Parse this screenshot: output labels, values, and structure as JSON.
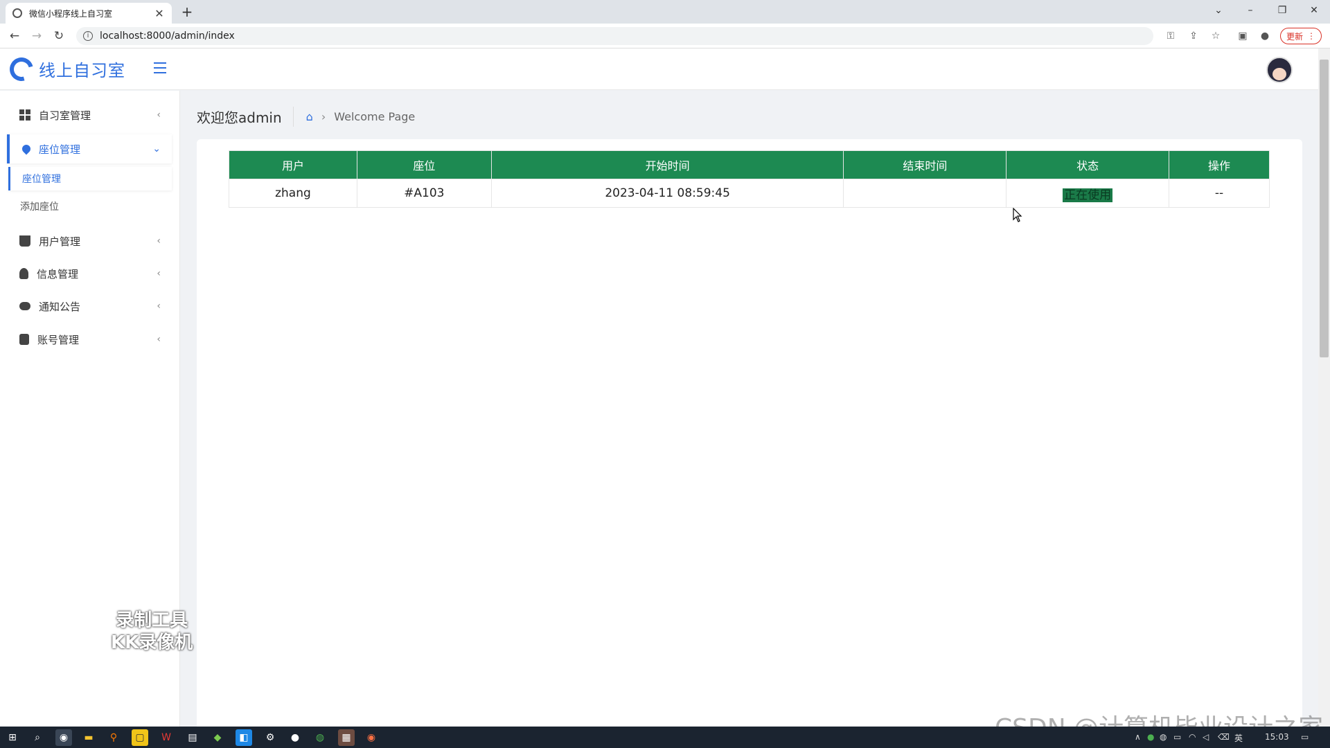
{
  "browser": {
    "tab_title": "微信小程序线上自习室",
    "url": "localhost:8000/admin/index",
    "update_label": "更新"
  },
  "app": {
    "brand": "线上自习室"
  },
  "sidebar": {
    "items": [
      {
        "label": "自习室管理",
        "icon": "grid-icon"
      },
      {
        "label": "座位管理",
        "icon": "drop-icon",
        "active": true
      },
      {
        "label": "用户管理",
        "icon": "basket-icon"
      },
      {
        "label": "信息管理",
        "icon": "bulb-icon"
      },
      {
        "label": "通知公告",
        "icon": "cloud-download-icon"
      },
      {
        "label": "账号管理",
        "icon": "database-icon"
      }
    ],
    "sub_items": [
      {
        "label": "座位管理",
        "active": true
      },
      {
        "label": "添加座位"
      }
    ]
  },
  "header": {
    "welcome": "欢迎您admin",
    "crumb": "Welcome Page"
  },
  "table": {
    "columns": [
      "用户",
      "座位",
      "开始时间",
      "结束时间",
      "状态",
      "操作"
    ],
    "rows": [
      {
        "user": "zhang",
        "seat": "#A103",
        "start": "2023-04-11 08:59:45",
        "end": "",
        "status": "正在使用",
        "action": "--"
      }
    ]
  },
  "overlay": {
    "recorder_line1": "录制工具",
    "recorder_line2": "KK录像机",
    "watermark": "CSDN @计算机毕业设计之家"
  },
  "taskbar": {
    "ime": "英",
    "time": "15:03"
  },
  "colors": {
    "accent": "#2f6fde",
    "table_header": "#1d8a52"
  }
}
